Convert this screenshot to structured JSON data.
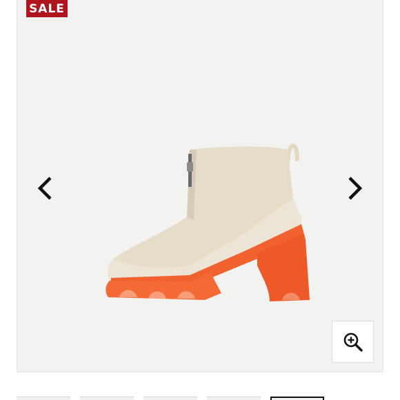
{
  "badge": {
    "label": "SALE",
    "color": "#b0141c"
  },
  "product_image": {
    "description_icon": "boot-image",
    "upper_color": "#e6ddc9",
    "sole_color": "#f2622e"
  },
  "navigation": {
    "prev_icon": "chevron-left-icon",
    "next_icon": "chevron-right-icon"
  },
  "zoom": {
    "icon": "zoom-in-icon"
  },
  "thumbnails": {
    "count": 5,
    "active_index": 4
  }
}
